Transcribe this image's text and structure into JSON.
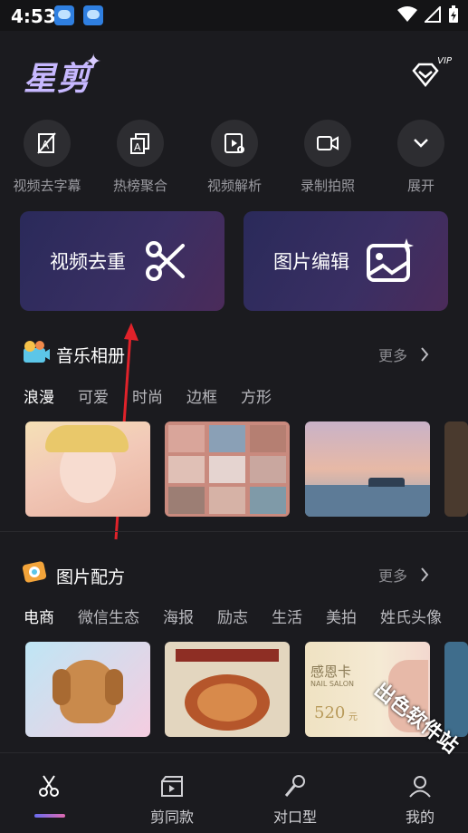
{
  "status_bar": {
    "time": "4:53"
  },
  "header": {
    "logo_text": "星剪",
    "vip_label": "VIP"
  },
  "tools": [
    {
      "label": "视频去字幕",
      "icon": "subtitle-off-icon"
    },
    {
      "label": "热榜聚合",
      "icon": "hot-list-icon"
    },
    {
      "label": "视频解析",
      "icon": "video-parse-icon"
    },
    {
      "label": "录制拍照",
      "icon": "camera-record-icon"
    },
    {
      "label": "展开",
      "icon": "chevron-down-icon"
    }
  ],
  "feature_cards": [
    {
      "label": "视频去重",
      "icon": "scissors-icon"
    },
    {
      "label": "图片编辑",
      "icon": "image-edit-icon"
    }
  ],
  "music_album": {
    "title": "音乐相册",
    "more": "更多",
    "tabs": [
      "浪漫",
      "可爱",
      "时尚",
      "边框",
      "方形"
    ],
    "active_tab": "浪漫"
  },
  "photo_recipe": {
    "title": "图片配方",
    "more": "更多",
    "tabs": [
      "电商",
      "微信生态",
      "海报",
      "励志",
      "生活",
      "美拍",
      "姓氏头像"
    ],
    "active_tab": "电商",
    "thumb_texts": {
      "card_title": "感恩卡",
      "card_sub": "NAIL SALON",
      "card_price": "520",
      "card_unit": "元"
    }
  },
  "bottom_nav": [
    {
      "label": "",
      "icon": "scissors-icon"
    },
    {
      "label": "剪同款",
      "icon": "clapper-icon"
    },
    {
      "label": "对口型",
      "icon": "microphone-icon"
    },
    {
      "label": "我的",
      "icon": "user-icon"
    }
  ],
  "watermark": "出色软件站",
  "colors": {
    "background": "#1b1b1f",
    "accent": "#7b6cf0",
    "annotation_arrow": "#e0222a"
  }
}
